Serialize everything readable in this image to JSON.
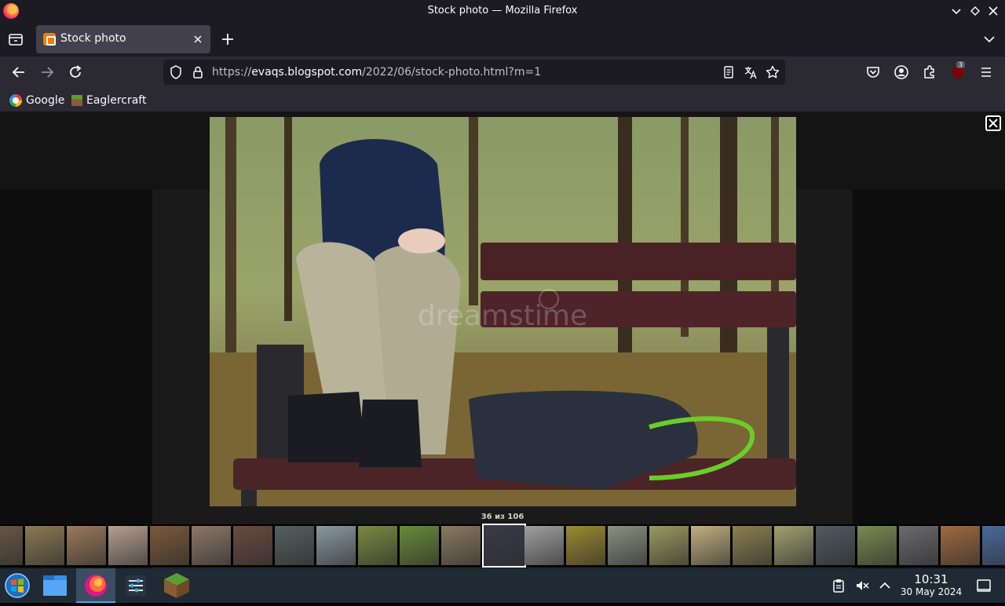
{
  "window": {
    "title": "Stock photo — Mozilla Firefox"
  },
  "tab": {
    "label": "Stock photo"
  },
  "url": {
    "host_prefix": "https://",
    "host": "evaqs.blogspot.com",
    "path": "/2022/06/stock-photo.html?m=1"
  },
  "bookmarks": [
    {
      "label": "Google"
    },
    {
      "label": "Eaglercraft"
    }
  ],
  "toolbar": {
    "extension_badge": "3"
  },
  "lightbox": {
    "counter": "36 из 106",
    "current_index": 36,
    "total": 106
  },
  "photo": {
    "watermark": "dreamstime"
  },
  "taskbar": {
    "time": "10:31",
    "date": "30 May 2024"
  },
  "colors": {
    "accent": "#3daee9",
    "chrome_dark": "#1c1b22",
    "chrome_toolbar": "#2b2a33",
    "taskbar": "#202a35"
  }
}
